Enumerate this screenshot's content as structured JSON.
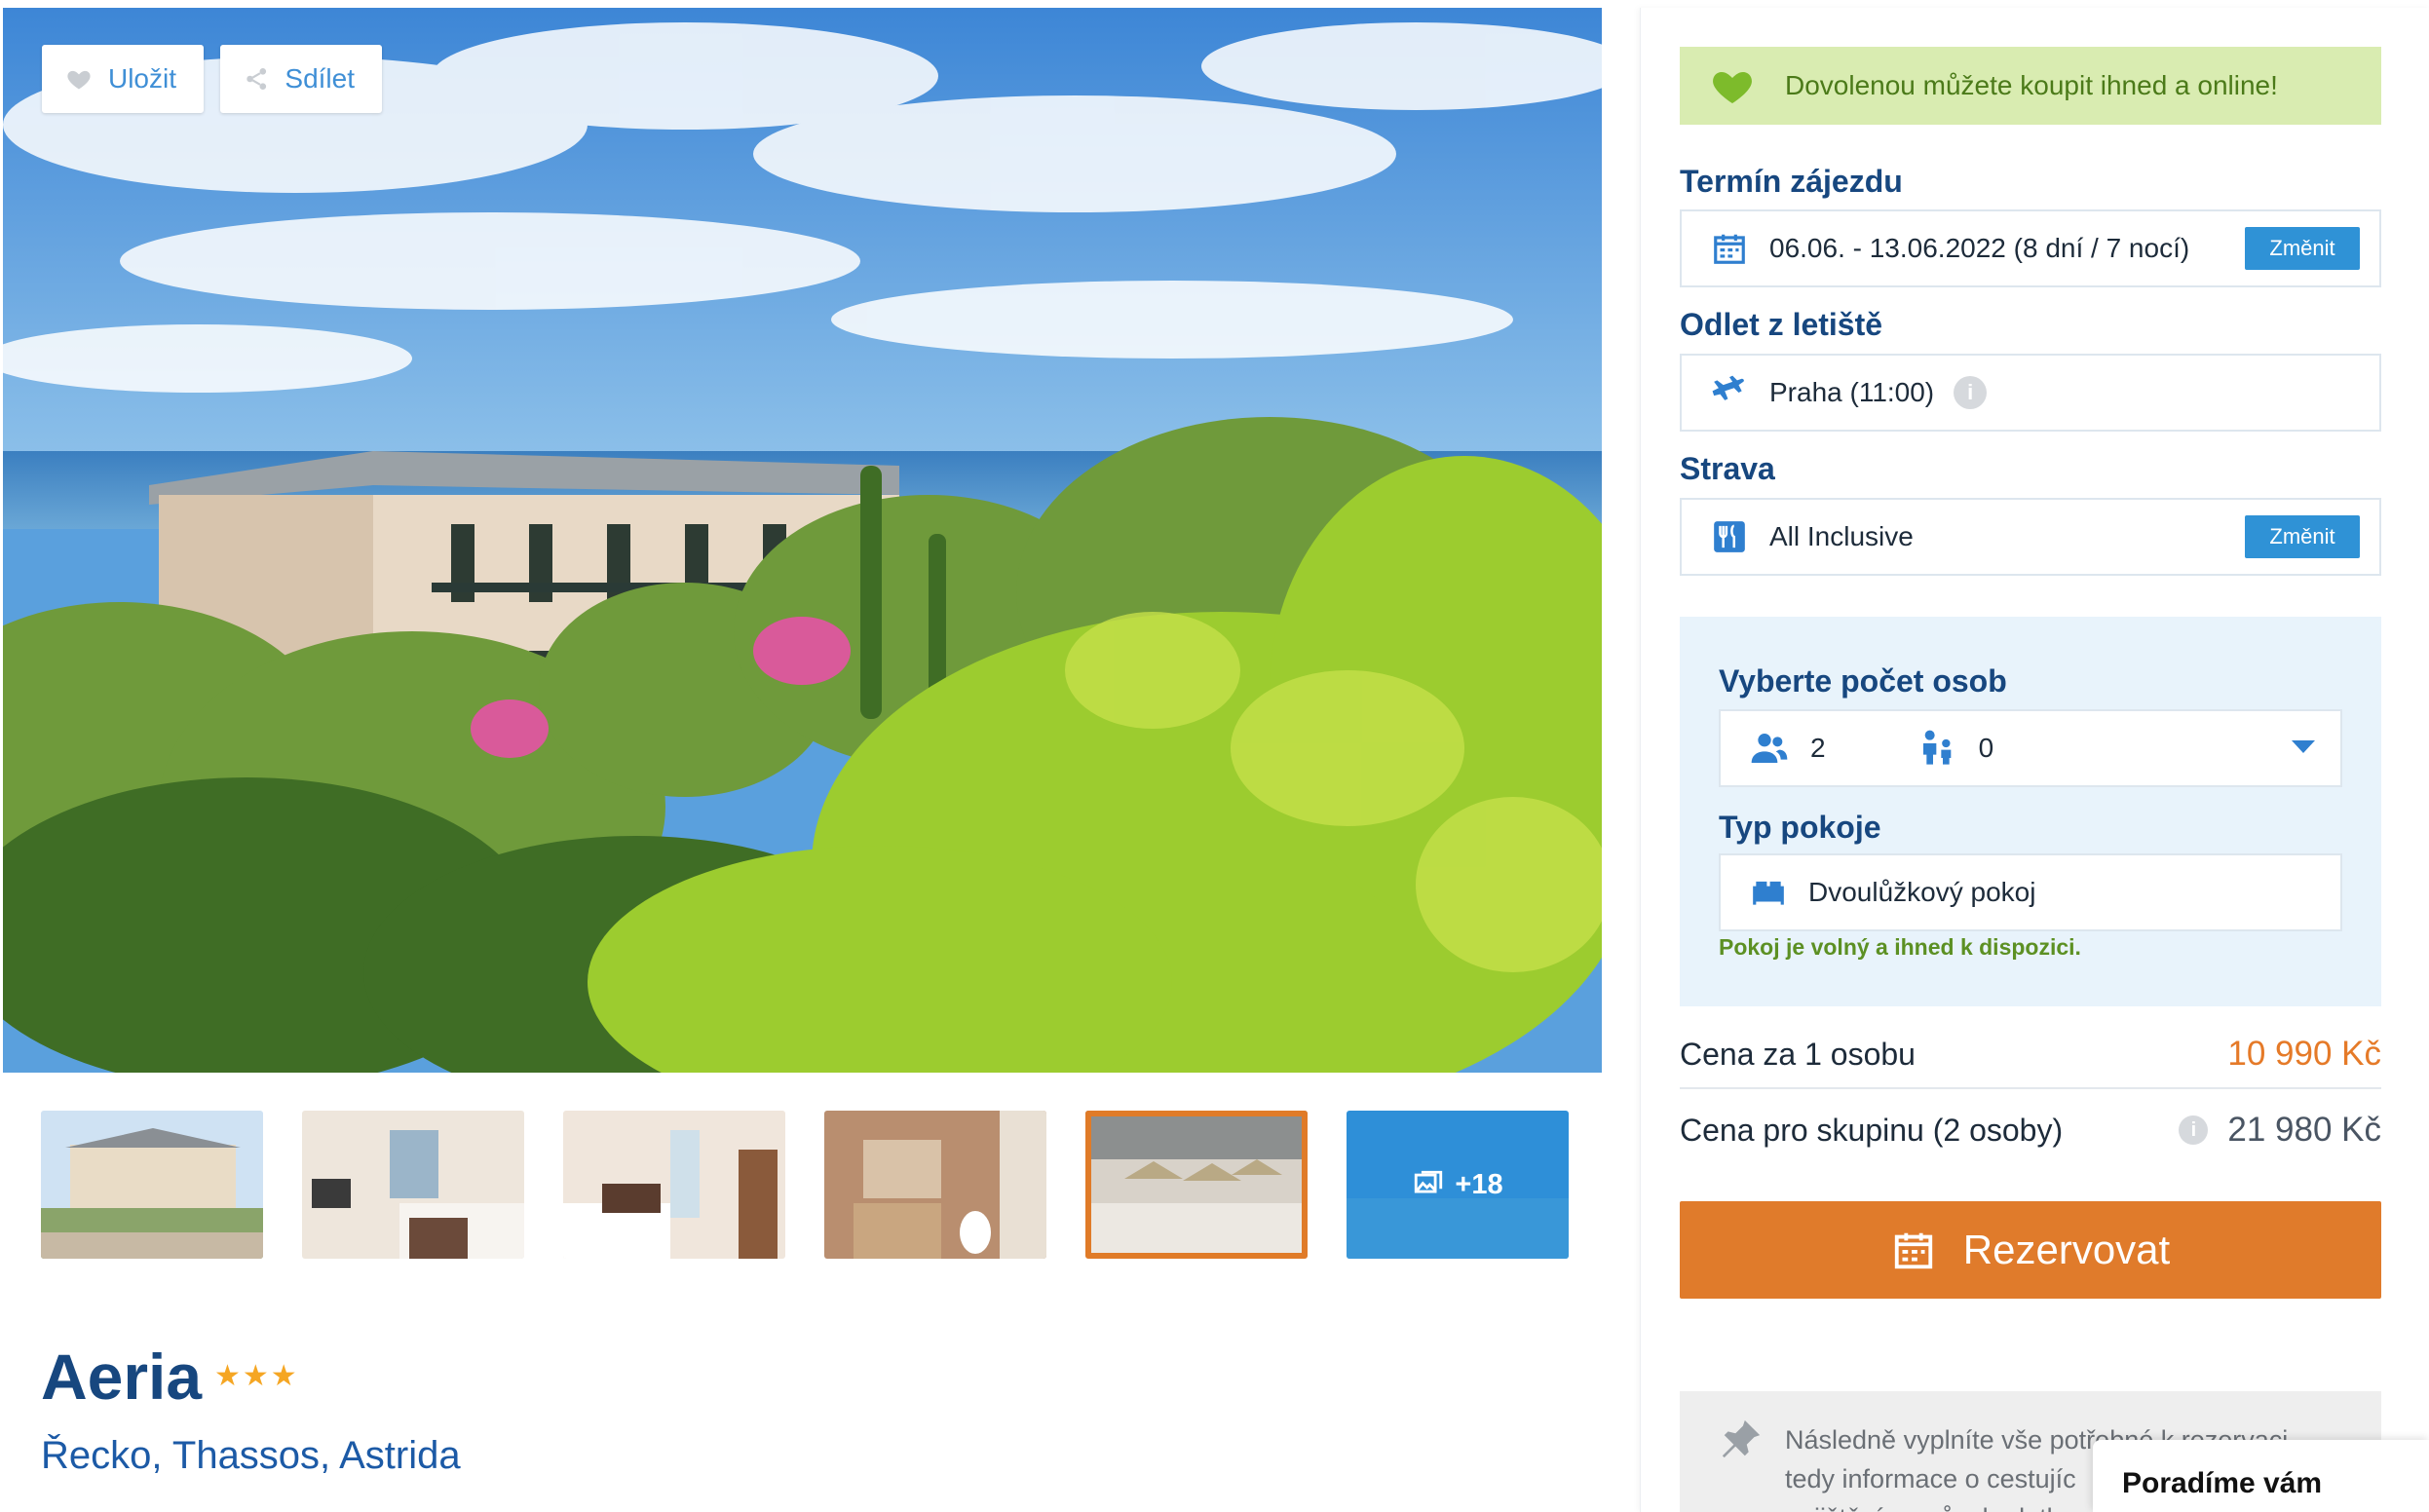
{
  "gallery": {
    "save_label": "Uložit",
    "share_label": "Sdílet",
    "more_count": "+18",
    "thumbs": [
      "hotel-exterior",
      "bedroom-1",
      "bedroom-2",
      "bathroom",
      "beach",
      "more"
    ]
  },
  "hotel": {
    "name": "Aeria",
    "stars": "★★★",
    "location": "Řecko, Thassos, Astrida"
  },
  "booking": {
    "online_banner": "Dovolenou můžete koupit ihned a online!",
    "term_label": "Termín zájezdu",
    "term_value": "06.06. - 13.06.2022 (8 dní / 7 nocí)",
    "change_label": "Změnit",
    "departure_label": "Odlet z letiště",
    "departure_value": "Praha (11:00)",
    "info_glyph": "i",
    "board_label": "Strava",
    "board_value": "All Inclusive",
    "persons_label": "Vyberte počet osob",
    "adults": "2",
    "children": "0",
    "room_label": "Typ pokoje",
    "room_value": "Dvoulůžkový pokoj",
    "room_available": "Pokoj je volný a ihned k dispozici.",
    "price_per_label": "Cena za 1 osobu",
    "price_per_value": "10 990 Kč",
    "price_group_label": "Cena pro skupinu (2 osoby)",
    "price_group_value": "21 980 Kč",
    "reserve_label": "Rezervovat",
    "note_line1": "Následně vyplníte vše potřebné k rezervaci.",
    "note_line2": "tedy informace o cestujíc",
    "note_line3": "pojištění a způsob platby",
    "advise_label": "Poradíme vám"
  },
  "colors": {
    "accent_blue": "#17477f",
    "button_blue": "#2f92d6",
    "orange": "#e07b2b",
    "banner_green": "#d9ecb1",
    "available_green": "#5c9023"
  }
}
